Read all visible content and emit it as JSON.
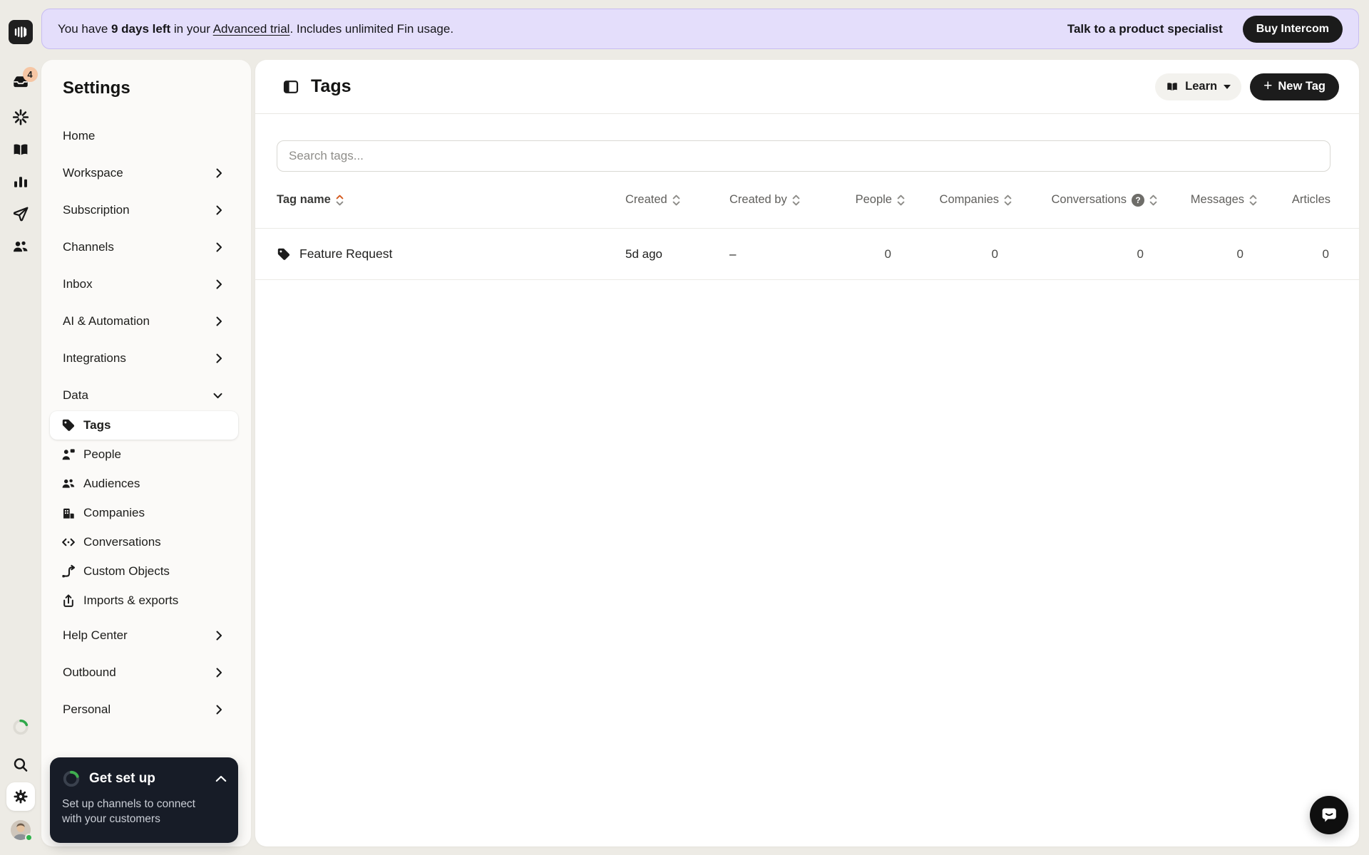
{
  "colors": {
    "page_bg": "#EDEBE5",
    "banner_bg": "#E4DEFB",
    "dark_button": "#1C1C1C",
    "badge_bg": "#F6C6A4",
    "progress_green": "#3FAE4F",
    "sort_active": "#D4591D",
    "getsetup_bg": "#171C27"
  },
  "banner": {
    "part1": "You have ",
    "days": "9 days left",
    "part2": " in your ",
    "link": "Advanced trial",
    "part3": ". Includes unlimited Fin usage.",
    "specialist": "Talk to a product specialist",
    "buy": "Buy Intercom"
  },
  "rail": {
    "inbox_badge": "4",
    "icons": [
      "intercom-logo",
      "inbox",
      "fin-ai",
      "knowledge",
      "reports",
      "outbound",
      "contacts",
      "setup-progress",
      "search",
      "settings",
      "account-avatar"
    ]
  },
  "sidebar": {
    "title": "Settings",
    "items": [
      {
        "label": "Home"
      },
      {
        "label": "Workspace"
      },
      {
        "label": "Subscription"
      },
      {
        "label": "Channels"
      },
      {
        "label": "Inbox"
      },
      {
        "label": "AI & Automation"
      },
      {
        "label": "Integrations"
      },
      {
        "label": "Data"
      },
      {
        "label": "Help Center"
      },
      {
        "label": "Outbound"
      },
      {
        "label": "Personal"
      }
    ],
    "data_children": [
      {
        "label": "Tags",
        "active": true
      },
      {
        "label": "People"
      },
      {
        "label": "Audiences"
      },
      {
        "label": "Companies"
      },
      {
        "label": "Conversations"
      },
      {
        "label": "Custom Objects"
      },
      {
        "label": "Imports & exports"
      }
    ],
    "get_set_up": {
      "title": "Get set up",
      "subtitle": "Set up channels to connect with your customers"
    }
  },
  "main": {
    "title": "Tags",
    "learn_button": "Learn",
    "new_tag_button": "New Tag",
    "search_placeholder": "Search tags...",
    "table": {
      "headers": {
        "tag_name": "Tag name",
        "created": "Created",
        "created_by": "Created by",
        "people": "People",
        "companies": "Companies",
        "conversations": "Conversations",
        "messages": "Messages",
        "articles": "Articles"
      },
      "help_glyph": "?",
      "rows": [
        {
          "name": "Feature Request",
          "created": "5d ago",
          "created_by": "–",
          "people": "0",
          "companies": "0",
          "conversations": "0",
          "messages": "0",
          "articles": "0"
        }
      ]
    }
  }
}
